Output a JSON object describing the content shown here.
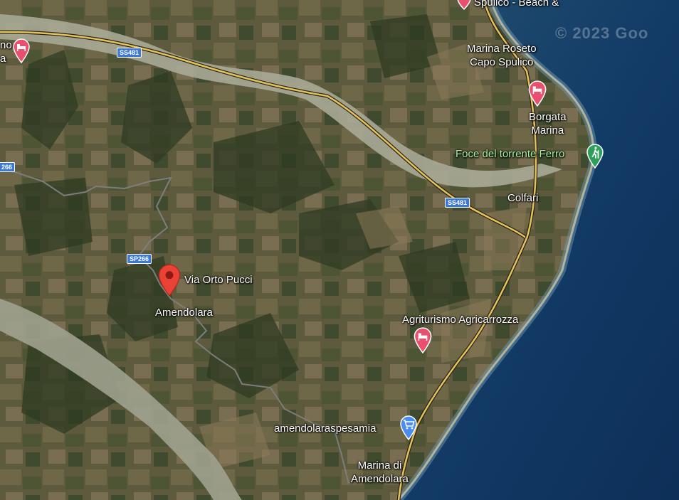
{
  "map": {
    "type": "satellite",
    "copyright": "© 2023 Goo",
    "roads": [
      {
        "id": "ss481-north",
        "shield": "SS481"
      },
      {
        "id": "ss481-south",
        "shield": "SS481"
      },
      {
        "id": "sp266",
        "shield": "SP266"
      },
      {
        "id": "sp266-edge",
        "shield": "266"
      }
    ],
    "places": [
      {
        "id": "spulico-beach",
        "text": "Spulico - Beach &"
      },
      {
        "id": "marina-roseto",
        "text": "Marina Roseto\nCapo Spulico"
      },
      {
        "id": "borgata-marina",
        "text": "Borgata\nMarina"
      },
      {
        "id": "foce-torrente",
        "text": "Foce del torrente Ferro"
      },
      {
        "id": "colfari",
        "text": "Colfari"
      },
      {
        "id": "via-orto-pucci",
        "text": "Via Orto Pucci"
      },
      {
        "id": "amendolara",
        "text": "Amendolara"
      },
      {
        "id": "agriturismo",
        "text": "Agriturismo Agricarrozza"
      },
      {
        "id": "amendolaraspesamia",
        "text": "amendolaraspesamia"
      },
      {
        "id": "marina-amendolara",
        "text": "Marina di\nAmendolara"
      },
      {
        "id": "left-edge",
        "text": "no\na"
      }
    ],
    "markers": [
      {
        "id": "selected-location",
        "icon": "red-location-pin-icon",
        "color": "#ea4335"
      },
      {
        "id": "hotel-left",
        "icon": "hotel-bed-icon",
        "color": "#e8506e"
      },
      {
        "id": "hotel-top",
        "icon": "hotel-bed-icon",
        "color": "#e8506e"
      },
      {
        "id": "hotel-borgata",
        "icon": "hotel-bed-icon",
        "color": "#e8506e"
      },
      {
        "id": "hotel-agriturismo",
        "icon": "hotel-bed-icon",
        "color": "#e8506e"
      },
      {
        "id": "hiking",
        "icon": "hiking-icon",
        "color": "#2e9e5b"
      },
      {
        "id": "shopping",
        "icon": "shopping-cart-icon",
        "color": "#4a8df0"
      }
    ]
  }
}
